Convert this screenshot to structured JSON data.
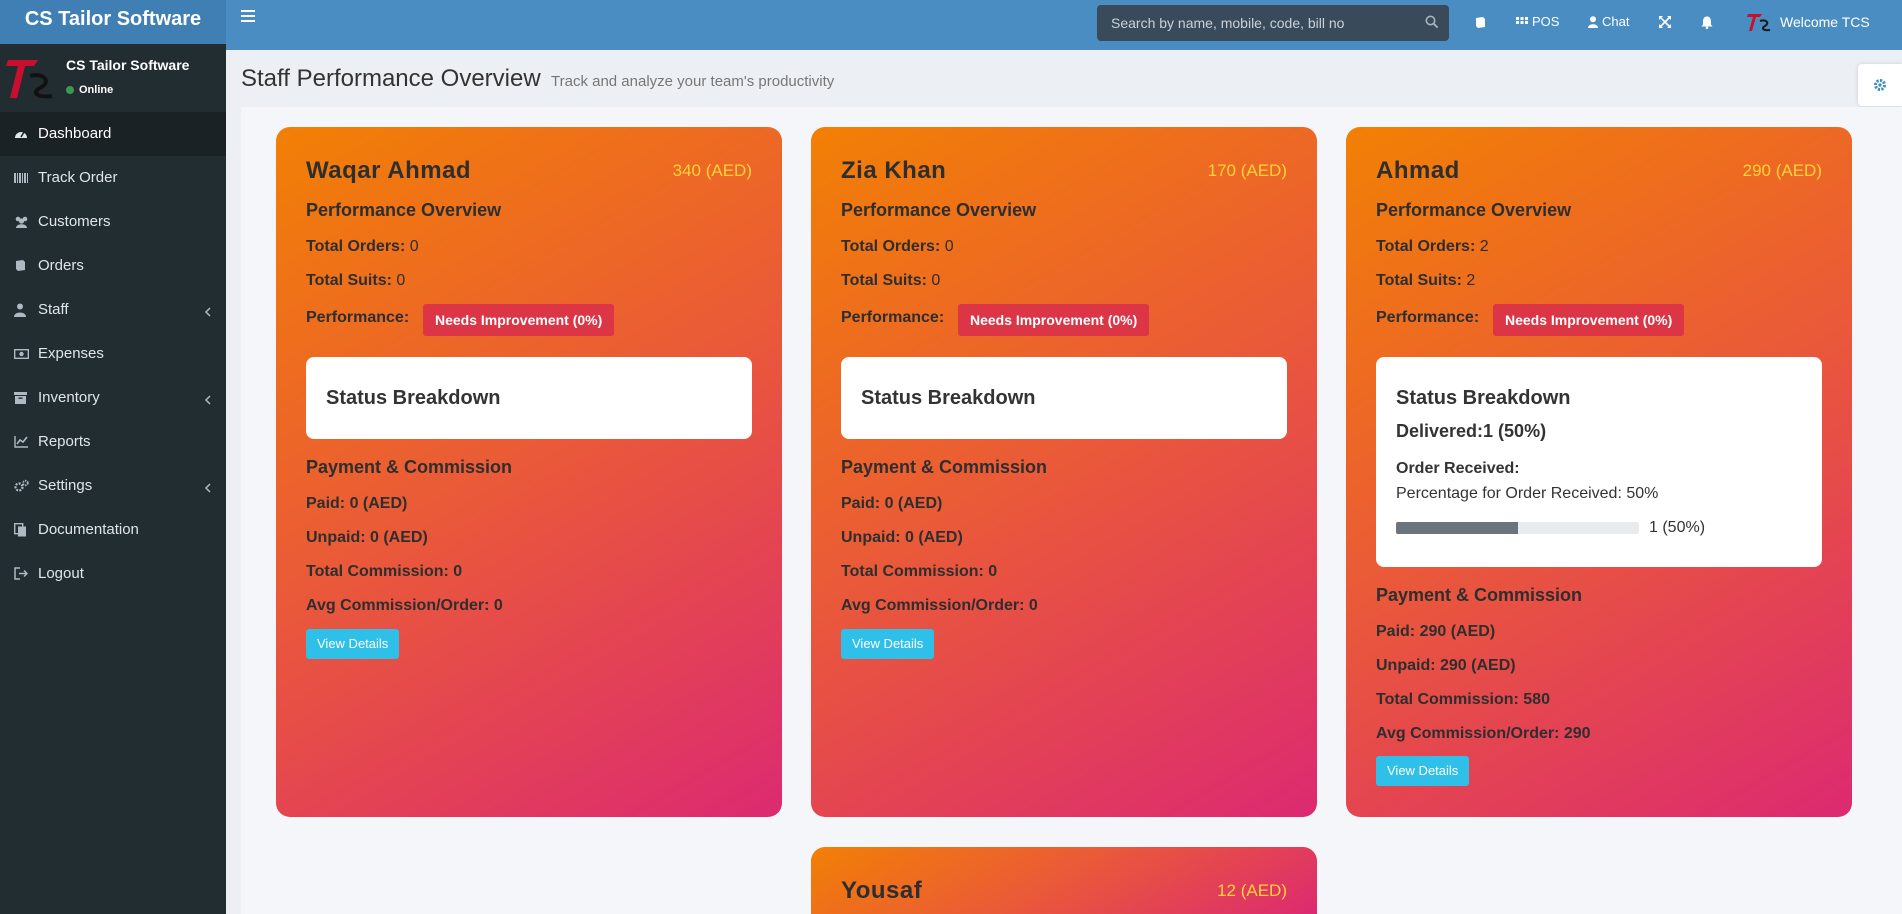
{
  "app": {
    "brand": "CS Tailor Software"
  },
  "header": {
    "search_placeholder": "Search by name, mobile, code, bill no",
    "pos_label": "POS",
    "chat_label": "Chat",
    "welcome_label": "Welcome TCS"
  },
  "sidebar": {
    "user_name": "CS Tailor Software",
    "status": "Online",
    "items": [
      {
        "label": "Dashboard",
        "icon": "dashboard-icon"
      },
      {
        "label": "Track Order",
        "icon": "barcode-icon"
      },
      {
        "label": "Customers",
        "icon": "users-icon"
      },
      {
        "label": "Orders",
        "icon": "book-icon"
      },
      {
        "label": "Staff",
        "icon": "user-tie-icon"
      },
      {
        "label": "Expenses",
        "icon": "money-icon"
      },
      {
        "label": "Inventory",
        "icon": "box-icon"
      },
      {
        "label": "Reports",
        "icon": "chart-line-icon"
      },
      {
        "label": "Settings",
        "icon": "cogs-icon"
      },
      {
        "label": "Documentation",
        "icon": "copy-icon"
      },
      {
        "label": "Logout",
        "icon": "sign-out-icon"
      }
    ]
  },
  "page": {
    "title": "Staff Performance Overview",
    "subtitle": "Track and analyze your team's productivity"
  },
  "cards": [
    {
      "name": "Waqar Ahmad",
      "amount": "340 (AED)",
      "performance_heading": "Performance Overview",
      "total_orders_label": "Total Orders:",
      "total_orders": "0",
      "total_suits_label": "Total Suits:",
      "total_suits": "0",
      "performance_label": "Performance:",
      "performance_badge": "Needs Improvement (0%)",
      "status_heading": "Status Breakdown",
      "payment_heading": "Payment & Commission",
      "paid": "Paid: 0 (AED)",
      "unpaid": "Unpaid: 0 (AED)",
      "total_commission": "Total Commission: 0",
      "avg_commission": "Avg Commission/Order: 0",
      "view_label": "View Details"
    },
    {
      "name": "Zia Khan",
      "amount": "170 (AED)",
      "performance_heading": "Performance Overview",
      "total_orders_label": "Total Orders:",
      "total_orders": "0",
      "total_suits_label": "Total Suits:",
      "total_suits": "0",
      "performance_label": "Performance:",
      "performance_badge": "Needs Improvement (0%)",
      "status_heading": "Status Breakdown",
      "payment_heading": "Payment & Commission",
      "paid": "Paid: 0 (AED)",
      "unpaid": "Unpaid: 0 (AED)",
      "total_commission": "Total Commission: 0",
      "avg_commission": "Avg Commission/Order: 0",
      "view_label": "View Details"
    },
    {
      "name": "Ahmad",
      "amount": "290 (AED)",
      "performance_heading": "Performance Overview",
      "total_orders_label": "Total Orders:",
      "total_orders": "2",
      "total_suits_label": "Total Suits:",
      "total_suits": "2",
      "performance_label": "Performance:",
      "performance_badge": "Needs Improvement (0%)",
      "status_heading": "Status Breakdown",
      "delivered": "Delivered:1 (50%)",
      "order_received_label": "Order Received:",
      "order_received_text": "Percentage for Order Received: 50%",
      "order_received_progress": 0.5,
      "order_received_bar_label": "1 (50%)",
      "payment_heading": "Payment & Commission",
      "paid": "Paid: 290 (AED)",
      "unpaid": "Unpaid: 290 (AED)",
      "total_commission": "Total Commission: 580",
      "avg_commission": "Avg Commission/Order: 290",
      "view_label": "View Details"
    },
    {
      "name": "Yousaf",
      "amount": "12 (AED)"
    }
  ],
  "colors": {
    "header": "#4a8dc3",
    "sidebar": "#222d32",
    "badge_danger": "#dc3545",
    "button_info": "#2fc0ea",
    "amount_text": "#ffd33a",
    "card_gradient_start": "#f28004",
    "card_gradient_end": "#dc2a71"
  }
}
